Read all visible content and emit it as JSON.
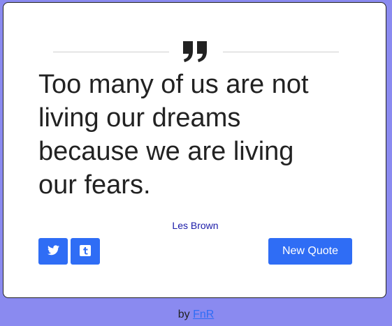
{
  "quote": {
    "text": "Too many of us are not living our dreams because we are living our fears.",
    "author": "Les Brown"
  },
  "buttons": {
    "twitter_icon": "twitter-icon",
    "tumblr_icon": "tumblr-icon",
    "new_quote_label": "New Quote"
  },
  "footer": {
    "prefix": "by",
    "link_text": "FnR"
  },
  "colors": {
    "background": "#8a8af0",
    "accent": "#2f6df5",
    "author": "#1a1aa8"
  }
}
